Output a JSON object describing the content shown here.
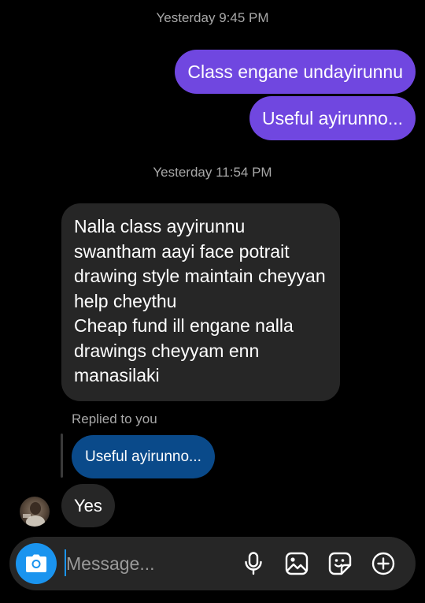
{
  "thread": {
    "timestamp_1": "Yesterday 9:45 PM",
    "outgoing": [
      "Class engane undayirunnu",
      "Useful ayirunno..."
    ],
    "timestamp_2": "Yesterday 11:54 PM",
    "incoming_long": {
      "lines": [
        "Nalla class ayyirunnu",
        "swantham aayi face potrait",
        "drawing style maintain cheyyan",
        "help cheythu",
        "Cheap fund ill engane nalla",
        "drawings cheyyam enn",
        "manasilaki"
      ]
    },
    "reply": {
      "label": "Replied to you",
      "quoted_text": "Useful ayirunno...",
      "message": "Yes"
    }
  },
  "composer": {
    "placeholder": "Message...",
    "icons": [
      "camera-icon",
      "microphone-icon",
      "gallery-icon",
      "sticker-icon",
      "add-icon"
    ]
  },
  "colors": {
    "outgoing_bubble": "#7047e0",
    "incoming_bubble": "#262626",
    "quoted_bubble": "#0a4a8a",
    "accent": "#1a94ef"
  }
}
